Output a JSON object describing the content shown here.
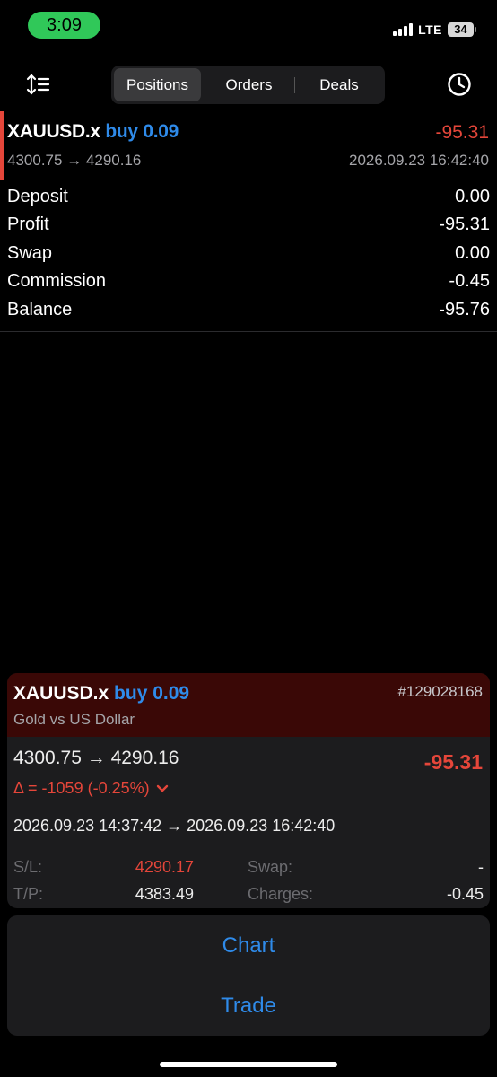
{
  "status_bar": {
    "time": "3:09",
    "network": "LTE",
    "battery": "34"
  },
  "tabs": [
    {
      "label": "Positions",
      "active": true
    },
    {
      "label": "Orders",
      "active": false
    },
    {
      "label": "Deals",
      "active": false
    }
  ],
  "position": {
    "symbol": "XAUUSD.x",
    "direction_volume": "buy 0.09",
    "profit": "-95.31",
    "price_open": "4300.75",
    "arrow": "→",
    "price_current": "4290.16",
    "datetime": "2026.09.23 16:42:40"
  },
  "summary": [
    {
      "label": "Deposit",
      "value": "0.00"
    },
    {
      "label": "Profit",
      "value": "-95.31"
    },
    {
      "label": "Swap",
      "value": "0.00"
    },
    {
      "label": "Commission",
      "value": "-0.45"
    },
    {
      "label": "Balance",
      "value": "-95.76"
    }
  ],
  "detail": {
    "symbol": "XAUUSD.x",
    "direction_volume": "buy 0.09",
    "ticket": "#129028168",
    "description": "Gold vs US Dollar",
    "prices": "4300.75 → 4290.16",
    "profit": "-95.31",
    "delta": "Δ = -1059 (-0.25%)",
    "times": "2026.09.23 14:37:42 → 2026.09.23 16:42:40",
    "sl_label": "S/L:",
    "sl_value": "4290.17",
    "tp_label": "T/P:",
    "tp_value": "4383.49",
    "swap_label": "Swap:",
    "swap_value": "-",
    "charges_label": "Charges:",
    "charges_value": "-0.45"
  },
  "actions": {
    "chart": "Chart",
    "trade": "Trade"
  },
  "colors": {
    "accent_blue": "#2f8bea",
    "loss_red": "#e5463a",
    "status_green": "#30c859",
    "card_header": "#3a0806"
  },
  "icons": {
    "sort": "sort-icon",
    "history": "clock-icon",
    "expand": "chevron-down-icon"
  }
}
